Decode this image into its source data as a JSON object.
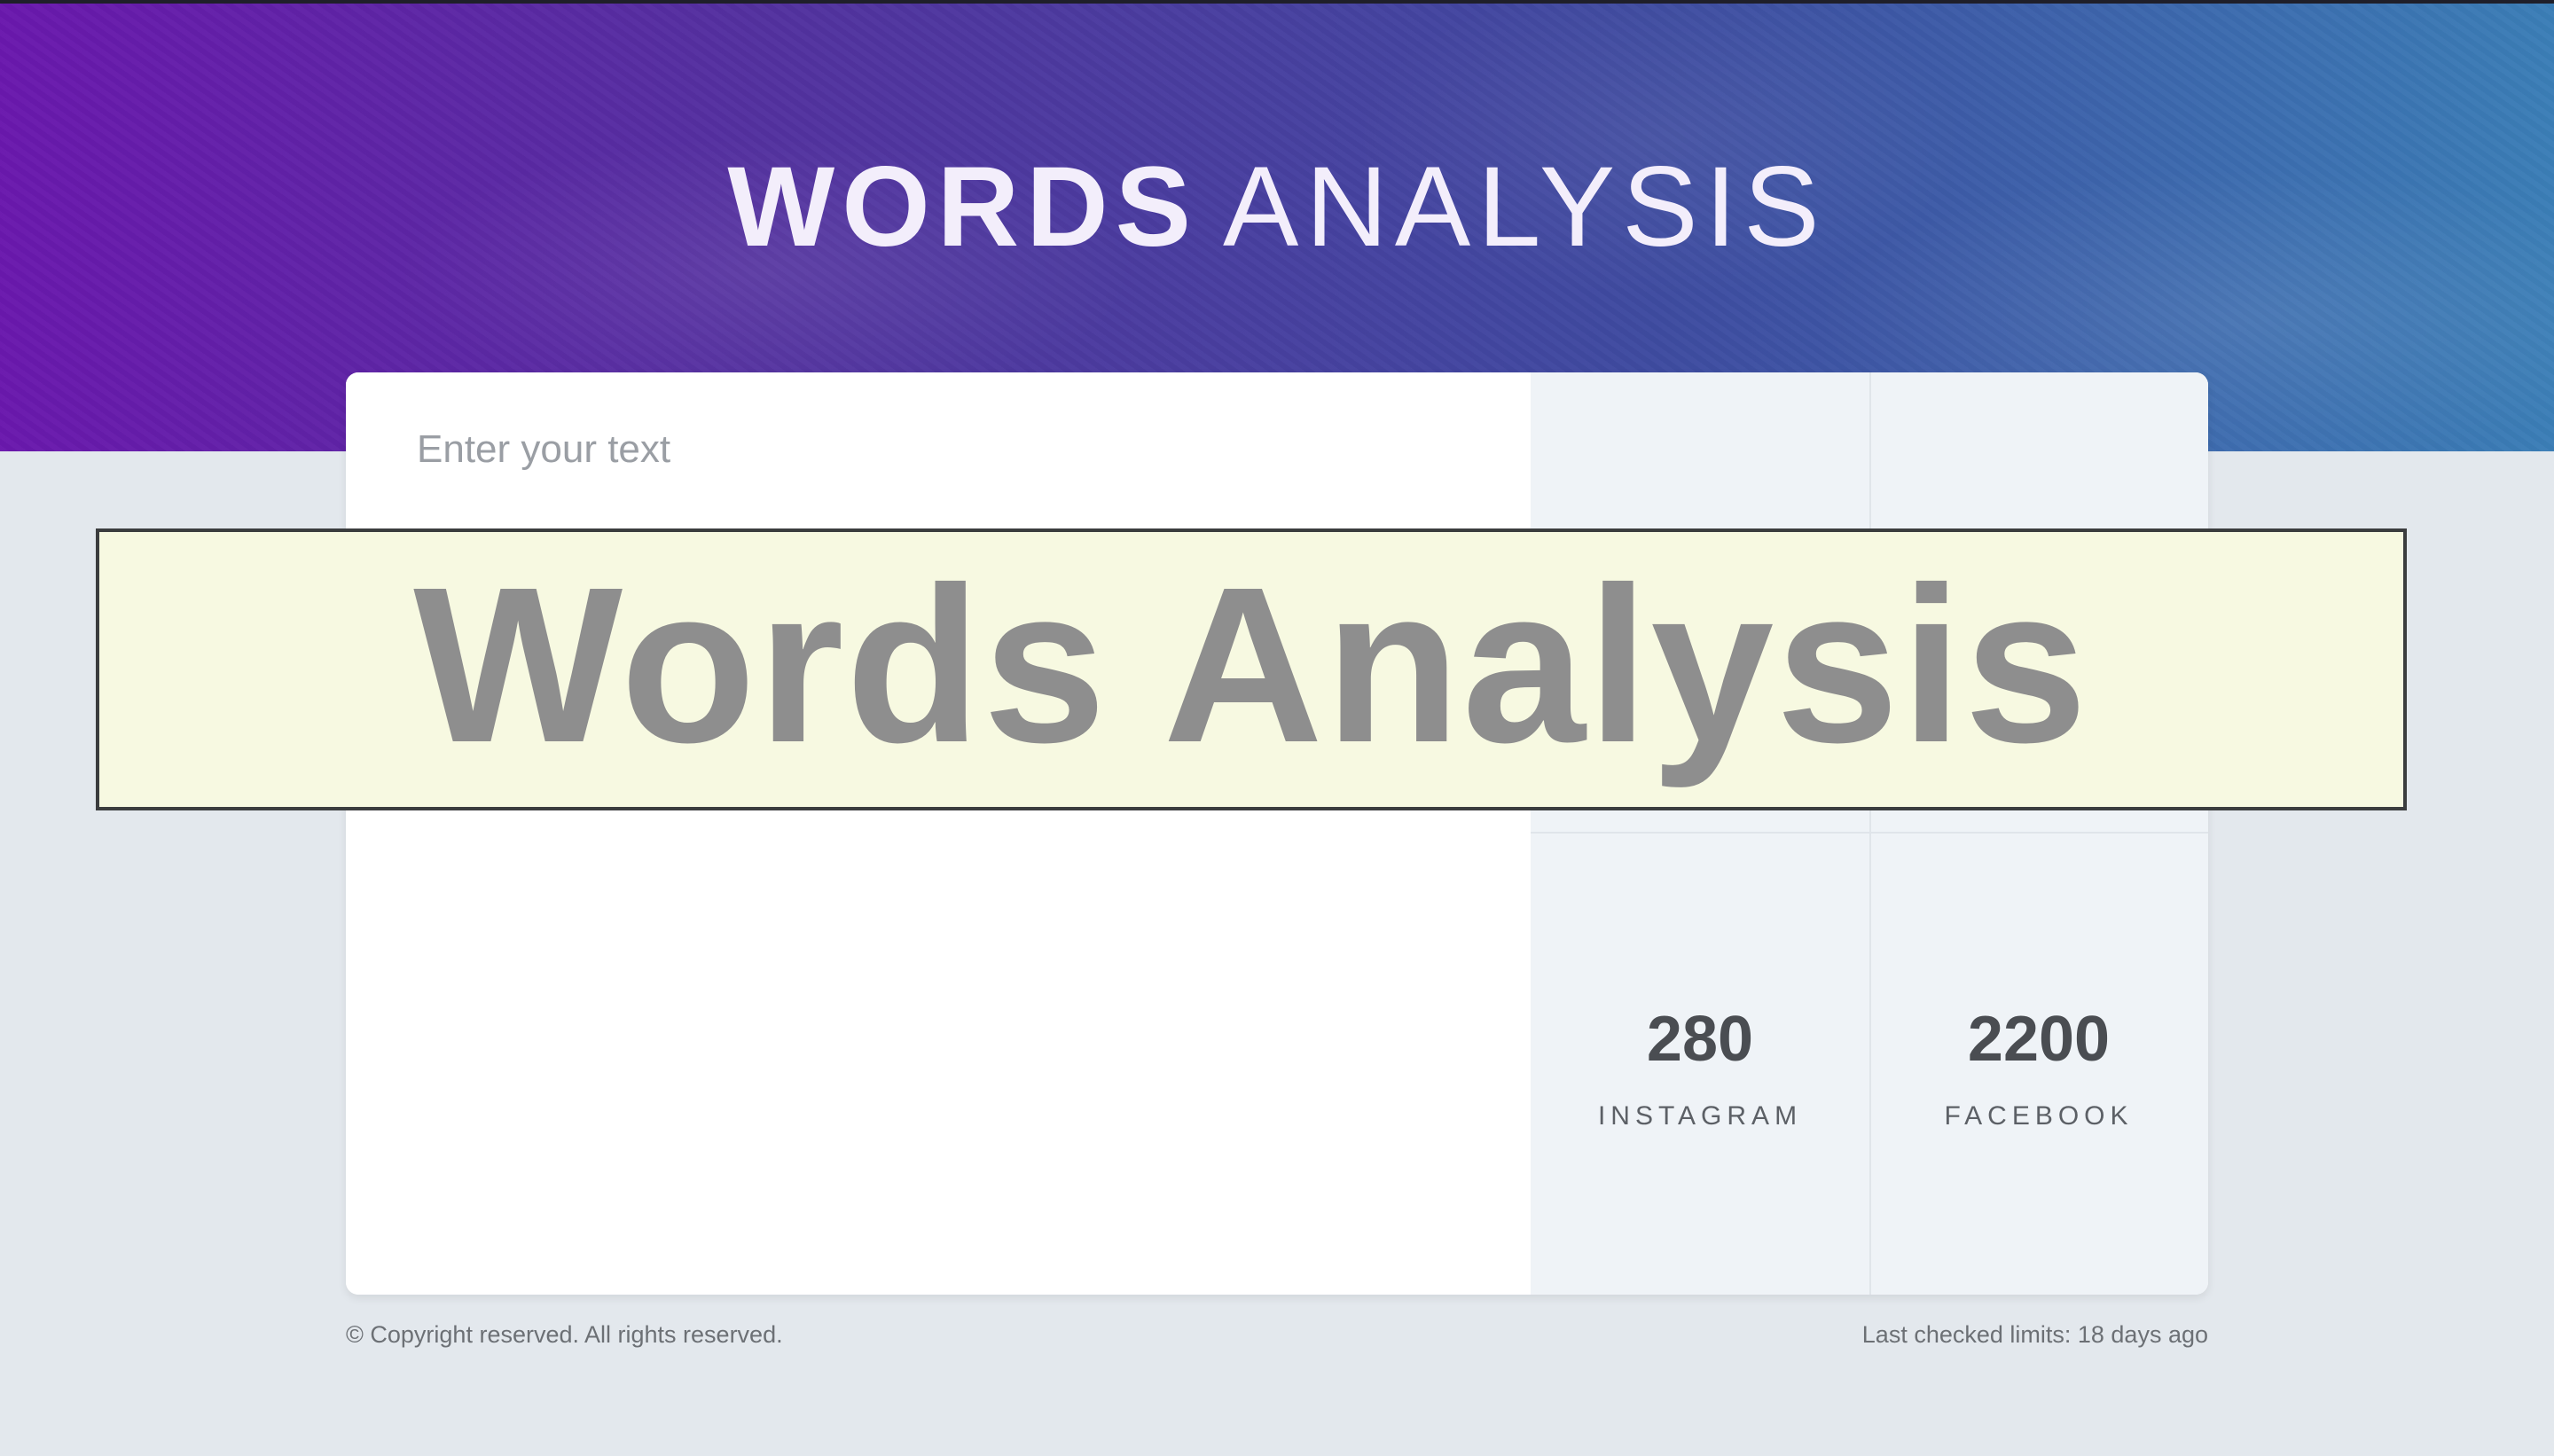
{
  "hero": {
    "title_bold": "WORDS",
    "title_light": "ANALYSIS"
  },
  "editor": {
    "placeholder": "Enter your text"
  },
  "stats": [
    {
      "value": "280",
      "label": "INSTAGRAM"
    },
    {
      "value": "2200",
      "label": "FACEBOOK"
    }
  ],
  "footer": {
    "copyright": "© Copyright reserved. All rights reserved.",
    "last_checked": "Last checked limits: 18 days ago"
  },
  "overlay_banner": {
    "text": "Words Analysis"
  },
  "colors": {
    "hero_gradient_start": "#6a18ad",
    "hero_gradient_end": "#3b7eb7",
    "page_background": "#e3e8ed",
    "stats_background": "#eff3f7",
    "banner_background": "#f7f9e1",
    "banner_text": "#8e8e8e"
  }
}
